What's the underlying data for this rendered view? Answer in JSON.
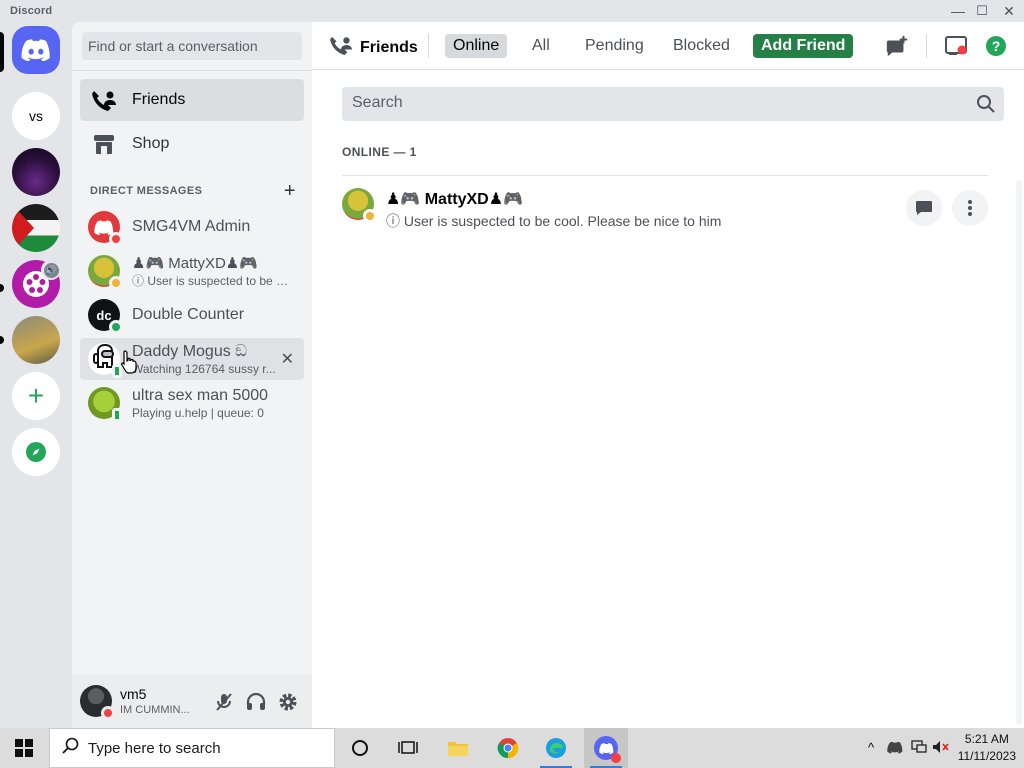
{
  "window": {
    "app_name": "Discord",
    "minimize": "—",
    "maximize": "☐",
    "close": "✕"
  },
  "servers": [
    {
      "name": "home",
      "icon": "discord-logo-icon"
    },
    {
      "name": "VS",
      "label": "vs"
    },
    {
      "name": "dark-server",
      "icon": "server-image"
    },
    {
      "name": "flag-server",
      "icon": "server-image"
    },
    {
      "name": "media-server",
      "icon": "server-image"
    },
    {
      "name": "anime-server",
      "icon": "server-image"
    },
    {
      "name": "add-server",
      "label": "+"
    },
    {
      "name": "explore",
      "icon": "compass-icon"
    }
  ],
  "sidebar": {
    "search_placeholder": "Find or start a conversation",
    "nav": [
      {
        "label": "Friends",
        "icon": "friends-icon"
      },
      {
        "label": "Shop",
        "icon": "shop-icon"
      }
    ],
    "dm_header": "DIRECT MESSAGES",
    "dm_add": "+",
    "dms": [
      {
        "name": "SMG4VM Admin",
        "sub": "",
        "status": "dnd"
      },
      {
        "name": "♟🎮 MattyXD♟🎮",
        "sub": "ⓘ User is suspected to be co...",
        "status": "idle"
      },
      {
        "name": "Double Counter",
        "sub": "",
        "status": "online"
      },
      {
        "name": "Daddy Mogus ඞ",
        "sub": "Watching 126764 sussy r...",
        "status": "mobile"
      },
      {
        "name": "ultra sex man 5000",
        "sub": "Playing u.help | queue: 0",
        "status": "mobile"
      }
    ],
    "close_dm": "✕"
  },
  "user": {
    "name": "vm5",
    "status": "IM CUMMIN..."
  },
  "topbar": {
    "title": "Friends",
    "tabs": [
      "Online",
      "All",
      "Pending",
      "Blocked"
    ],
    "selected_tab": "Online",
    "add_friend": "Add Friend"
  },
  "main": {
    "search_placeholder": "Search",
    "online_header": "ONLINE — 1",
    "friends": [
      {
        "name": "♟🎮 MattyXD♟🎮",
        "status_text": "ⓘ User is suspected to be cool. Please be nice to him"
      }
    ]
  },
  "taskbar": {
    "search_placeholder": "Type here to search",
    "time": "5:21 AM",
    "date": "11/11/2023"
  },
  "colors": {
    "blurple": "#5865f2",
    "green": "#248046",
    "dnd": "#f23f43",
    "online": "#23a55a",
    "idle": "#f0b232"
  }
}
